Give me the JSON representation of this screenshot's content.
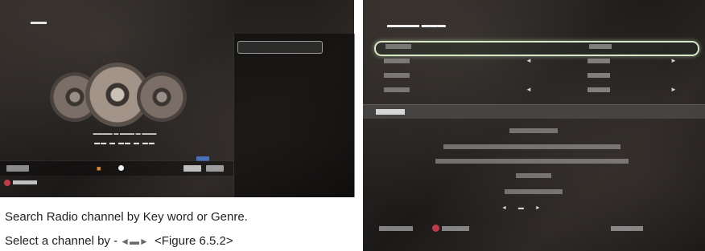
{
  "captions": {
    "line1": "Search Radio channel by Key word or Genre.",
    "line2_before": "Select a channel by",
    "line2_dashes": "-",
    "line2_after": "<Figure 6.5.2>",
    "icon": "remote-arrow-keys-icon"
  },
  "colors": {
    "screen_bg": "#2a2623",
    "highlight_border": "#d7e6c7",
    "red_key": "#c23a4a",
    "accent_orange": "#e08a2a",
    "badge_blue": "#4a70b8"
  }
}
